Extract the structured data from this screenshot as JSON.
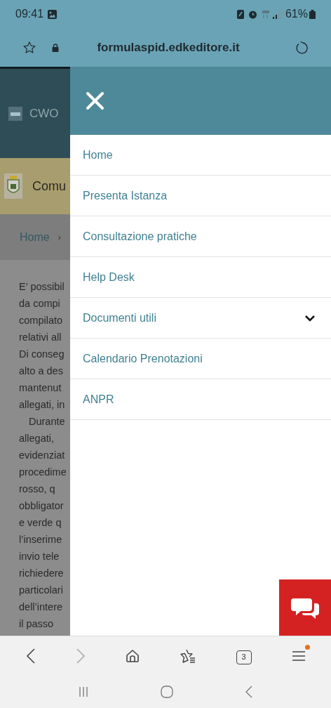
{
  "status_bar": {
    "time": "09:41",
    "battery": "61%"
  },
  "address_bar": {
    "url": "formulaspid.edkeditore.it"
  },
  "page_behind": {
    "site_name": "CWO",
    "municipality": "Comu",
    "breadcrumb": [
      "Home",
      "›"
    ],
    "text_lines": [
      "E’ possibil",
      "da compi",
      "compilato",
      "relativi all",
      "Di conseg",
      "alto a des",
      "mantenut",
      "allegati, in",
      "Durante",
      "allegati,",
      "evidenziat",
      "procedime",
      "rosso, q",
      "obbligator",
      "e verde q",
      "l’inserime",
      "invio tele",
      "richiedere",
      "particolari",
      "dell’intere",
      "il passo"
    ]
  },
  "menu": {
    "items": [
      {
        "label": "Home",
        "kind": "link"
      },
      {
        "label": "Presenta Istanza",
        "kind": "link"
      },
      {
        "label": "Consultazione pratiche",
        "kind": "link"
      },
      {
        "label": "Help Desk",
        "kind": "link"
      },
      {
        "label": "Documenti utili",
        "kind": "dropdown",
        "expanded": false
      },
      {
        "label": "Calendario Prenotazioni",
        "kind": "link"
      },
      {
        "label": "ANPR",
        "kind": "link"
      }
    ]
  },
  "browser_toolbar": {
    "tabs_count": "3",
    "menu_notification": true
  }
}
